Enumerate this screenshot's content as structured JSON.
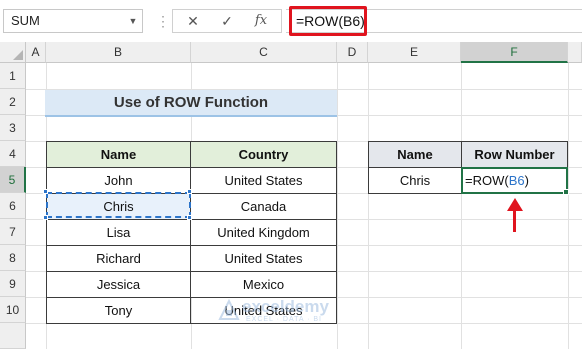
{
  "formula_bar": {
    "name_box": "SUM",
    "name_box_dropdown": "▼",
    "separator": "⋮",
    "cancel_glyph": "✕",
    "enter_glyph": "✓",
    "function_glyph": "fx",
    "formula": "=ROW(B6)",
    "highlight_color": "#e0141e"
  },
  "columns": [
    "A",
    "B",
    "C",
    "D",
    "E",
    "F"
  ],
  "rows": [
    "1",
    "2",
    "3",
    "4",
    "5",
    "6",
    "7",
    "8",
    "9",
    "10"
  ],
  "title": "Use of ROW Function",
  "left_table": {
    "headers": [
      "Name",
      "Country"
    ],
    "rows": [
      [
        "John",
        "United States"
      ],
      [
        "Chris",
        "Canada"
      ],
      [
        "Lisa",
        "United Kingdom"
      ],
      [
        "Richard",
        "United States"
      ],
      [
        "Jessica",
        "Mexico"
      ],
      [
        "Tony",
        "United States"
      ]
    ]
  },
  "right_table": {
    "headers": [
      "Name",
      "Row Number"
    ],
    "row": {
      "name": "Chris",
      "formula_prefix": "=ROW(",
      "formula_ref": "B6",
      "formula_suffix": ")"
    }
  },
  "watermark": {
    "name": "exceldemy",
    "tagline": "EXCEL · DATA · BI"
  },
  "colors": {
    "header_green": "#e2efda",
    "header_gray": "#e4e7ec",
    "title_band": "#dce9f6",
    "selection_green": "#217346",
    "ref_blue": "#2c74c9",
    "arrow_red": "#e0141e"
  }
}
